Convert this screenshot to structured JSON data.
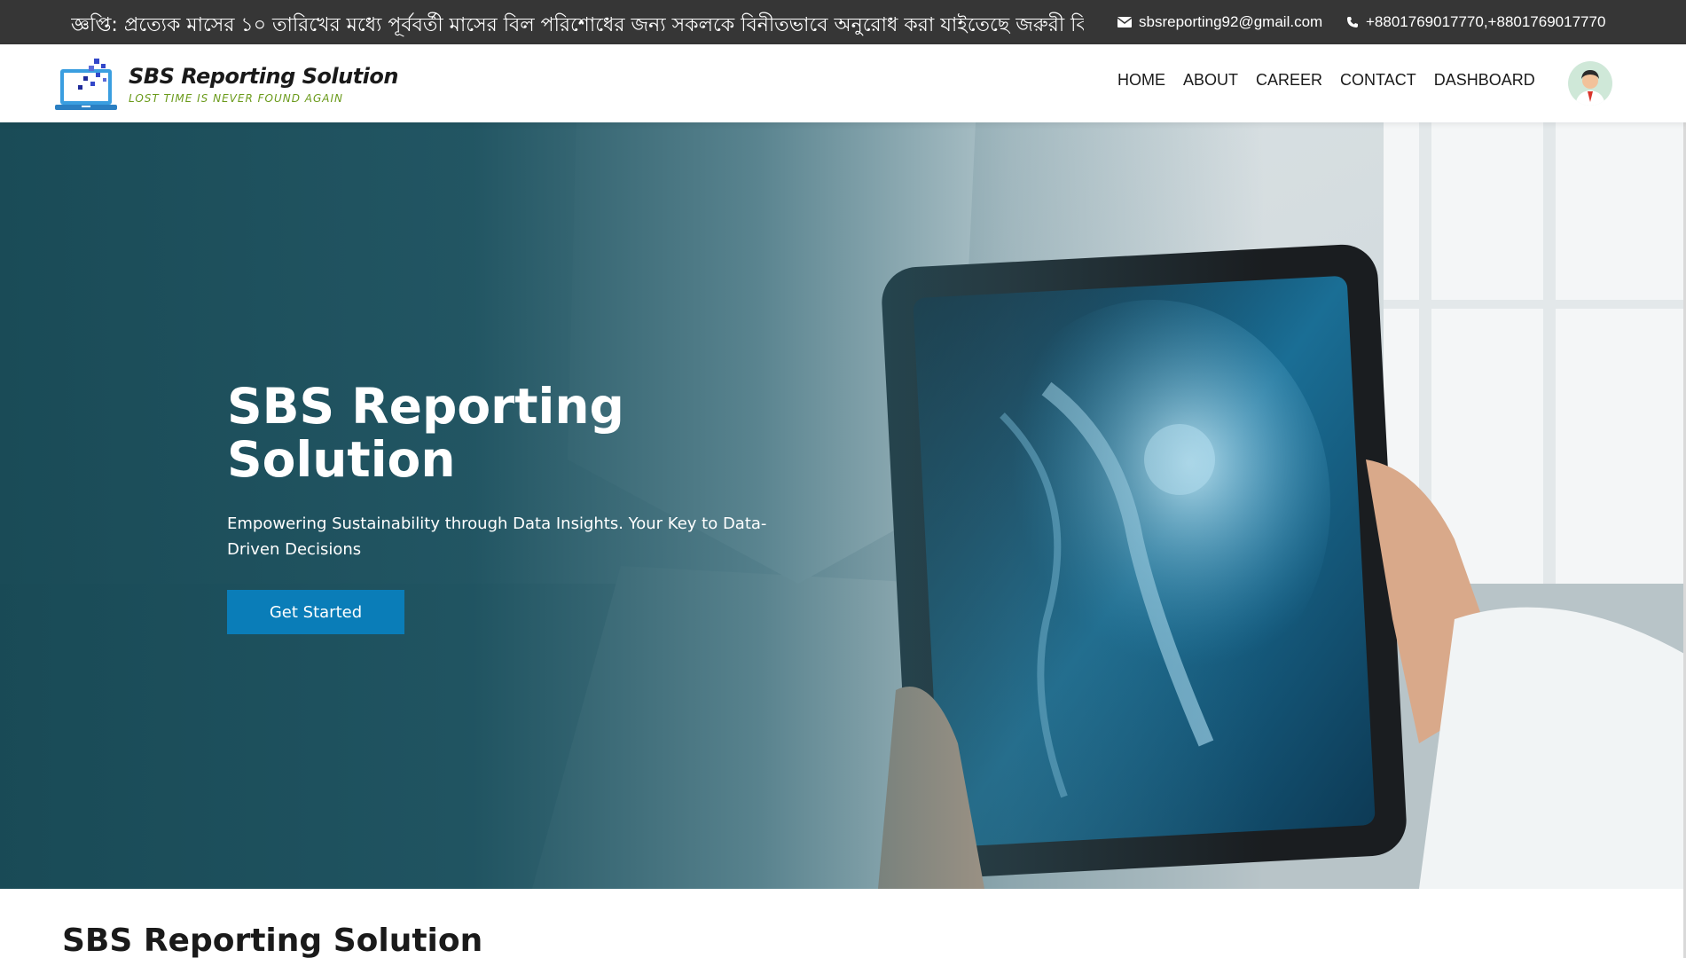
{
  "topbar": {
    "notice": "জ্ঞপ্তি: প্রত্যেক মাসের ১০ তারিখের মধ্যে পূর্ববর্তী মাসের বিল পরিশোধের জন্য সকলকে বিনীতভাবে অনুরোধ করা যাইতেছে      জরুরী বি",
    "email": "sbsreporting92@gmail.com",
    "phone": "+8801769017770,+8801769017770"
  },
  "header": {
    "logo_title": "SBS Reporting Solution",
    "logo_tagline": "LOST TIME IS NEVER FOUND AGAIN",
    "nav": [
      "HOME",
      "ABOUT",
      "CAREER",
      "CONTACT",
      "DASHBOARD"
    ]
  },
  "hero": {
    "title": "SBS Reporting Solution",
    "subtitle": "Empowering Sustainability through Data Insights. Your Key to Data-Driven Decisions",
    "button": "Get Started"
  },
  "section": {
    "title": "SBS Reporting Solution"
  },
  "colors": {
    "topbar_bg": "#363636",
    "hero_overlay": "#164854",
    "button": "#0a7db8",
    "tagline": "#6a9a1a"
  },
  "icons": [
    "mail-icon",
    "phone-icon",
    "logo-monitor-icon",
    "user-avatar-icon"
  ]
}
